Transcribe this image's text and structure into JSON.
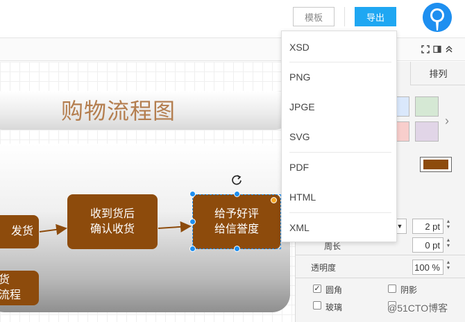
{
  "header": {
    "template_button": "模板",
    "export_button": "导出"
  },
  "canvas": {
    "title": "购物流程图",
    "nodes": {
      "ship": "发货",
      "receive_line1": "收到货后",
      "receive_line2": "确认收货",
      "review_line1": "给予好评",
      "review_line2": "给信誉度",
      "return_line1": "货",
      "return_line2": "流程"
    }
  },
  "right_panel": {
    "tab_arrange": "排列",
    "swatch_colors": [
      "#dae8fc",
      "#d5e8d4",
      "#f8cecc",
      "#e1d5e7"
    ],
    "fill_color": "#8d4b0c",
    "spin_value_1": "2 pt",
    "perimeter_label": "周长",
    "spin_value_2": "0 pt",
    "opacity_label": "透明度",
    "opacity_value": "100 %",
    "rounded_label": "圆角",
    "shadow_label": "阴影",
    "glass_label": "玻璃"
  },
  "export_menu": {
    "items": [
      "XSD",
      "PNG",
      "JPGE",
      "SVG",
      "PDF",
      "HTML",
      "XML"
    ]
  },
  "watermark": "@51CTO博客",
  "colors": {
    "accent": "#1fa7f2",
    "node_fill": "#8d4b0c",
    "title_color": "#b47e4f",
    "selection": "#1e8ff0"
  }
}
